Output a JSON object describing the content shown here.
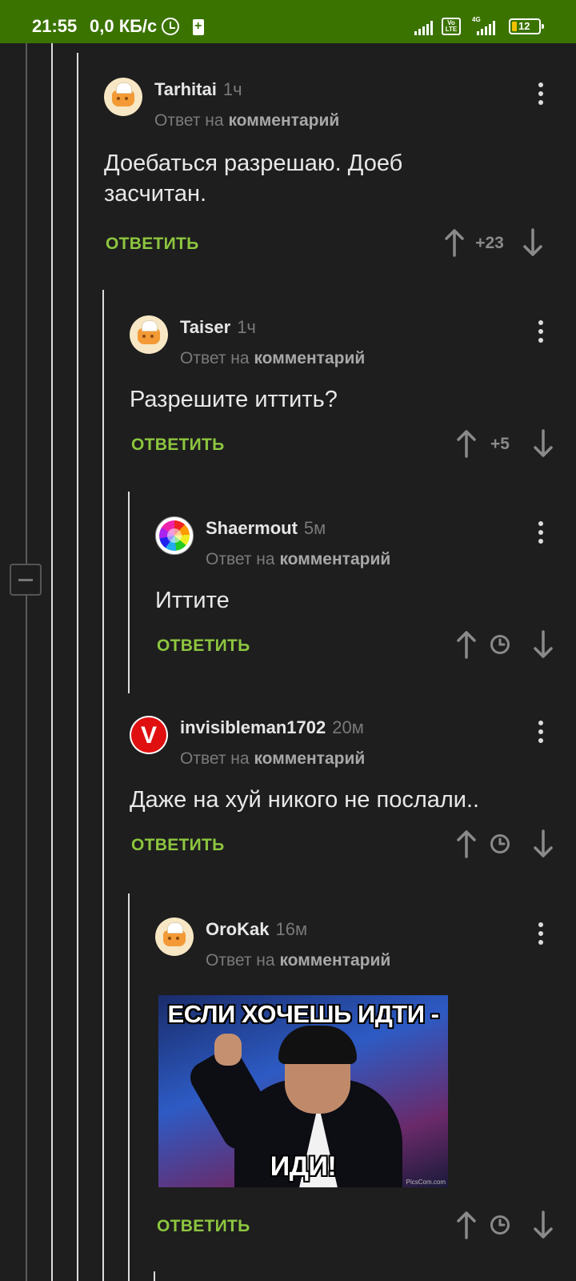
{
  "status_bar": {
    "time": "21:55",
    "net_speed": "0,0 КБ/с",
    "volte_label": "Vo LTE",
    "network_type": "4G",
    "battery_level": "12",
    "background_color": "#3b7300"
  },
  "common": {
    "reply_prefix": "Ответ на",
    "reply_target": "комментарий",
    "reply_button": "ОТВЕТИТЬ",
    "accent_color": "#8dc63f"
  },
  "comments": [
    {
      "author": "Tarhitai",
      "time": "1ч",
      "text": "Доебаться разрешаю. Доеб засчитан.",
      "score": "+23",
      "avatar_icon": "chef-tart-avatar"
    },
    {
      "author": "Taiser",
      "time": "1ч",
      "text": "Разрешите иттить?",
      "score": "+5",
      "avatar_icon": "chef-tart-avatar"
    },
    {
      "author": "Shaermout",
      "time": "5м",
      "text": "Иттите",
      "score": null,
      "avatar_icon": "color-burst-avatar"
    },
    {
      "author": "invisibleman1702",
      "time": "20м",
      "text": "Даже на хуй никого не послали..",
      "score": null,
      "avatar_icon": "red-v-avatar"
    },
    {
      "author": "OroKak",
      "time": "16м",
      "text": "",
      "score": null,
      "avatar_icon": "chef-tart-avatar",
      "image": {
        "caption_top": "ЕСЛИ ХОЧЕШЬ ИДТИ -",
        "caption_bottom": "ИДИ!",
        "watermark": "PicsCom.com"
      }
    }
  ]
}
